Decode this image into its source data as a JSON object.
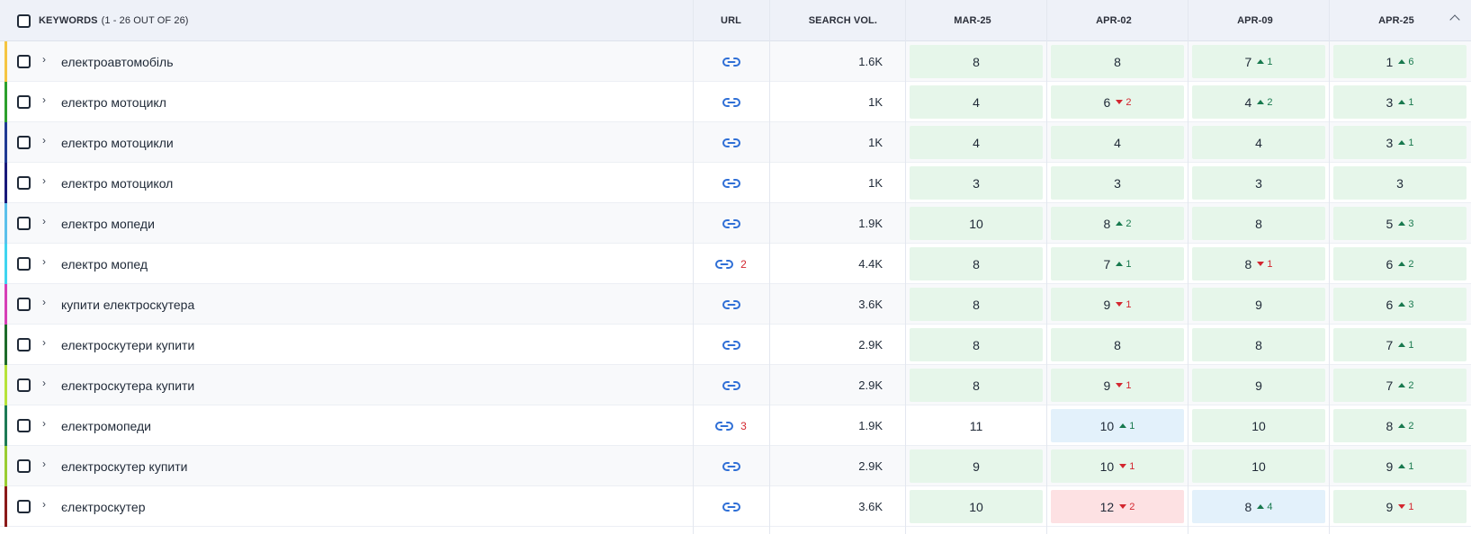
{
  "header": {
    "keywords_label": "KEYWORDS",
    "keywords_count": "(1 - 26 OUT OF 26)",
    "url_label": "URL",
    "search_vol_label": "SEARCH VOL.",
    "dates": [
      "MAR-25",
      "APR-02",
      "APR-09",
      "APR-25"
    ]
  },
  "icons": {
    "link": "link-icon",
    "chevron": "chevron-right-icon",
    "sort": "chevron-up-icon"
  },
  "colors": {
    "green": "#e6f6ea",
    "blue": "#e3f1fb",
    "red": "#fde1e3",
    "up": "#18794e",
    "down": "#d3262f"
  },
  "rows": [
    {
      "keyword": "електроавтомобіль",
      "url_badge": "",
      "volume": "1.6K",
      "accent": "#f5c542",
      "positions": [
        {
          "v": "8",
          "d": "",
          "dir": "",
          "bg": "green"
        },
        {
          "v": "8",
          "d": "",
          "dir": "",
          "bg": "green"
        },
        {
          "v": "7",
          "d": "1",
          "dir": "up",
          "bg": "green"
        },
        {
          "v": "1",
          "d": "6",
          "dir": "up",
          "bg": "green"
        }
      ]
    },
    {
      "keyword": "електро мотоцикл",
      "url_badge": "",
      "volume": "1K",
      "accent": "#2ca02c",
      "positions": [
        {
          "v": "4",
          "d": "",
          "dir": "",
          "bg": "green"
        },
        {
          "v": "6",
          "d": "2",
          "dir": "down",
          "bg": "green"
        },
        {
          "v": "4",
          "d": "2",
          "dir": "up",
          "bg": "green"
        },
        {
          "v": "3",
          "d": "1",
          "dir": "up",
          "bg": "green"
        }
      ]
    },
    {
      "keyword": "електро мотоцикли",
      "url_badge": "",
      "volume": "1K",
      "accent": "#1f3a93",
      "positions": [
        {
          "v": "4",
          "d": "",
          "dir": "",
          "bg": "green"
        },
        {
          "v": "4",
          "d": "",
          "dir": "",
          "bg": "green"
        },
        {
          "v": "4",
          "d": "",
          "dir": "",
          "bg": "green"
        },
        {
          "v": "3",
          "d": "1",
          "dir": "up",
          "bg": "green"
        }
      ]
    },
    {
      "keyword": "електро мотоцикол",
      "url_badge": "",
      "volume": "1K",
      "accent": "#1a1a7a",
      "positions": [
        {
          "v": "3",
          "d": "",
          "dir": "",
          "bg": "green"
        },
        {
          "v": "3",
          "d": "",
          "dir": "",
          "bg": "green"
        },
        {
          "v": "3",
          "d": "",
          "dir": "",
          "bg": "green"
        },
        {
          "v": "3",
          "d": "",
          "dir": "",
          "bg": "green"
        }
      ]
    },
    {
      "keyword": "електро мопеди",
      "url_badge": "",
      "volume": "1.9K",
      "accent": "#5bc0eb",
      "positions": [
        {
          "v": "10",
          "d": "",
          "dir": "",
          "bg": "green"
        },
        {
          "v": "8",
          "d": "2",
          "dir": "up",
          "bg": "green"
        },
        {
          "v": "8",
          "d": "",
          "dir": "",
          "bg": "green"
        },
        {
          "v": "5",
          "d": "3",
          "dir": "up",
          "bg": "green"
        }
      ]
    },
    {
      "keyword": "електро мопед",
      "url_badge": "2",
      "volume": "4.4K",
      "accent": "#3fd5f0",
      "positions": [
        {
          "v": "8",
          "d": "",
          "dir": "",
          "bg": "green"
        },
        {
          "v": "7",
          "d": "1",
          "dir": "up",
          "bg": "green"
        },
        {
          "v": "8",
          "d": "1",
          "dir": "down",
          "bg": "green"
        },
        {
          "v": "6",
          "d": "2",
          "dir": "up",
          "bg": "green"
        }
      ]
    },
    {
      "keyword": "купити електроскутера",
      "url_badge": "",
      "volume": "3.6K",
      "accent": "#d63fb6",
      "positions": [
        {
          "v": "8",
          "d": "",
          "dir": "",
          "bg": "green"
        },
        {
          "v": "9",
          "d": "1",
          "dir": "down",
          "bg": "green"
        },
        {
          "v": "9",
          "d": "",
          "dir": "",
          "bg": "green"
        },
        {
          "v": "6",
          "d": "3",
          "dir": "up",
          "bg": "green"
        }
      ]
    },
    {
      "keyword": "електроскутери купити",
      "url_badge": "",
      "volume": "2.9K",
      "accent": "#1e6b2a",
      "positions": [
        {
          "v": "8",
          "d": "",
          "dir": "",
          "bg": "green"
        },
        {
          "v": "8",
          "d": "",
          "dir": "",
          "bg": "green"
        },
        {
          "v": "8",
          "d": "",
          "dir": "",
          "bg": "green"
        },
        {
          "v": "7",
          "d": "1",
          "dir": "up",
          "bg": "green"
        }
      ]
    },
    {
      "keyword": "електроскутера купити",
      "url_badge": "",
      "volume": "2.9K",
      "accent": "#b6e33a",
      "positions": [
        {
          "v": "8",
          "d": "",
          "dir": "",
          "bg": "green"
        },
        {
          "v": "9",
          "d": "1",
          "dir": "down",
          "bg": "green"
        },
        {
          "v": "9",
          "d": "",
          "dir": "",
          "bg": "green"
        },
        {
          "v": "7",
          "d": "2",
          "dir": "up",
          "bg": "green"
        }
      ]
    },
    {
      "keyword": "електромопеди",
      "url_badge": "3",
      "volume": "1.9K",
      "accent": "#1d7a55",
      "positions": [
        {
          "v": "11",
          "d": "",
          "dir": "",
          "bg": "none"
        },
        {
          "v": "10",
          "d": "1",
          "dir": "up",
          "bg": "blue"
        },
        {
          "v": "10",
          "d": "",
          "dir": "",
          "bg": "green"
        },
        {
          "v": "8",
          "d": "2",
          "dir": "up",
          "bg": "green"
        }
      ]
    },
    {
      "keyword": "електроскутер купити",
      "url_badge": "",
      "volume": "2.9K",
      "accent": "#9acd32",
      "positions": [
        {
          "v": "9",
          "d": "",
          "dir": "",
          "bg": "green"
        },
        {
          "v": "10",
          "d": "1",
          "dir": "down",
          "bg": "green"
        },
        {
          "v": "10",
          "d": "",
          "dir": "",
          "bg": "green"
        },
        {
          "v": "9",
          "d": "1",
          "dir": "up",
          "bg": "green"
        }
      ]
    },
    {
      "keyword": "єлектроскутер",
      "url_badge": "",
      "volume": "3.6K",
      "accent": "#8b1a1a",
      "positions": [
        {
          "v": "10",
          "d": "",
          "dir": "",
          "bg": "green"
        },
        {
          "v": "12",
          "d": "2",
          "dir": "down",
          "bg": "red"
        },
        {
          "v": "8",
          "d": "4",
          "dir": "up",
          "bg": "blue"
        },
        {
          "v": "9",
          "d": "1",
          "dir": "down",
          "bg": "green"
        }
      ]
    }
  ]
}
